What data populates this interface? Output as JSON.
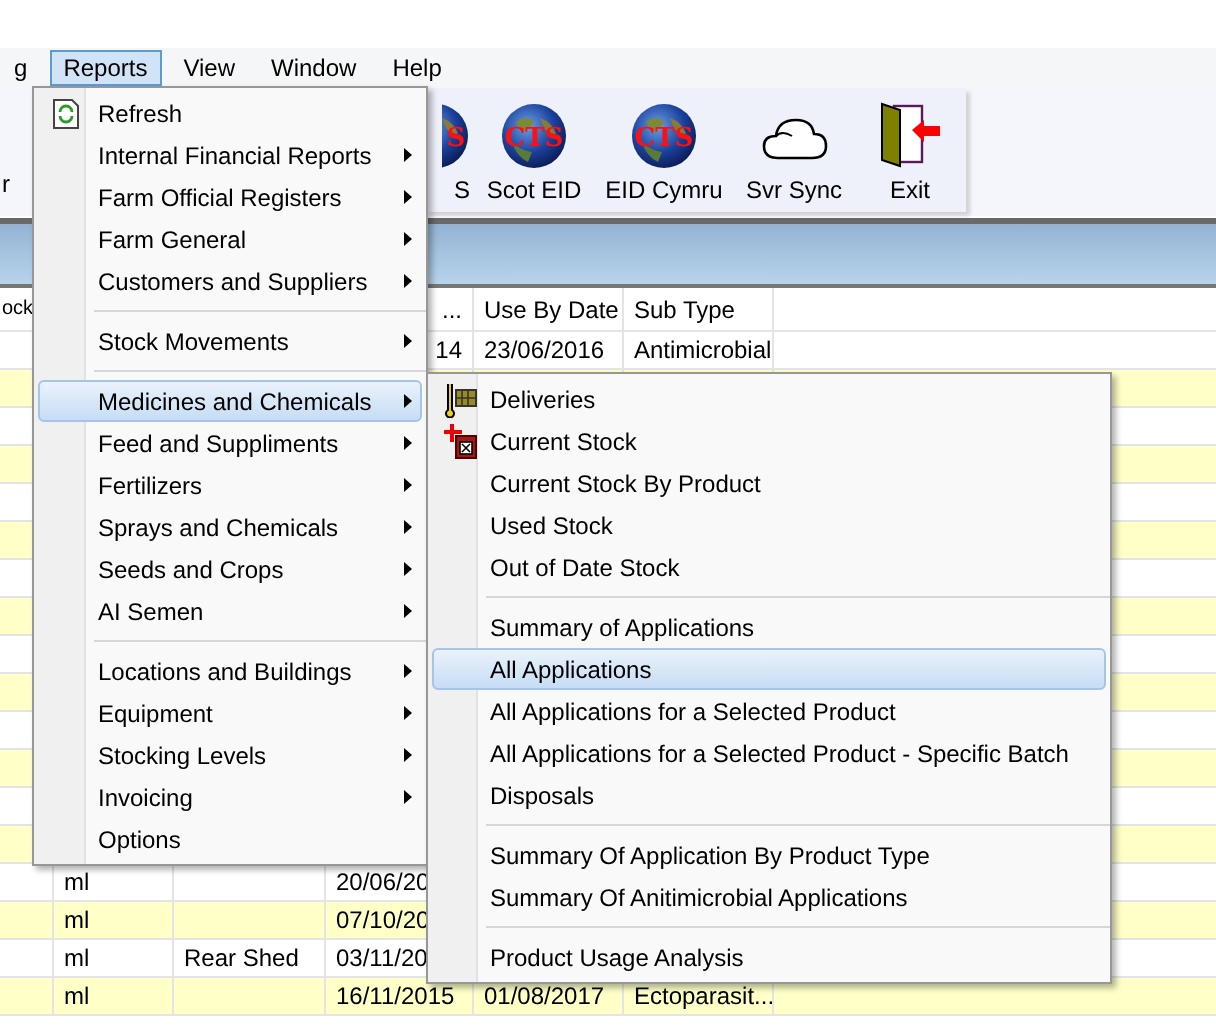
{
  "menu_bar": [
    {
      "label": "g",
      "selected": false
    },
    {
      "label": "Reports",
      "selected": true
    },
    {
      "label": "View",
      "selected": false
    },
    {
      "label": "Window",
      "selected": false
    },
    {
      "label": "Help",
      "selected": false
    }
  ],
  "toolbar": {
    "left_label": "r",
    "buttons": [
      {
        "label": "S",
        "badge": "S",
        "kind": "globe"
      },
      {
        "label": "Scot EID",
        "badge": "CTS",
        "kind": "globe"
      },
      {
        "label": "EID Cymru",
        "badge": "CTS",
        "kind": "globe"
      },
      {
        "label": "Svr Sync",
        "kind": "cloud"
      },
      {
        "label": "Exit",
        "kind": "door"
      }
    ]
  },
  "grid": {
    "columns": [
      "ock",
      "...",
      "Use By Date",
      "Sub Type"
    ],
    "top_rows": [
      {
        "column_4": "14",
        "column_5": "23/06/2016",
        "column_6": "Antimicrobial"
      }
    ],
    "bottom_rows": [
      {
        "column_2": "ml",
        "column_4": "20/06/20"
      },
      {
        "column_2": "ml",
        "column_4": "07/10/20"
      },
      {
        "column_2": "ml",
        "column_3": "Rear Shed",
        "column_4": "03/11/20"
      },
      {
        "column_2": "ml",
        "column_4": "16/11/2015",
        "column_5": "01/08/2017",
        "column_6": "Ectoparasit..."
      }
    ]
  },
  "reports_menu": [
    {
      "kind": "item",
      "label": "Refresh",
      "submenu": false,
      "selected": false
    },
    {
      "kind": "item",
      "label": "Internal Financial Reports",
      "submenu": true,
      "selected": false
    },
    {
      "kind": "item",
      "label": "Farm Official Registers",
      "submenu": true,
      "selected": false
    },
    {
      "kind": "item",
      "label": "Farm General",
      "submenu": true,
      "selected": false
    },
    {
      "kind": "item",
      "label": "Customers and Suppliers",
      "submenu": true,
      "selected": false
    },
    {
      "kind": "separator"
    },
    {
      "kind": "item",
      "label": "Stock Movements",
      "submenu": true,
      "selected": false
    },
    {
      "kind": "separator"
    },
    {
      "kind": "item",
      "label": "Medicines and Chemicals",
      "submenu": true,
      "selected": true
    },
    {
      "kind": "item",
      "label": "Feed and Suppliments",
      "submenu": true,
      "selected": false
    },
    {
      "kind": "item",
      "label": "Fertilizers",
      "submenu": true,
      "selected": false
    },
    {
      "kind": "item",
      "label": "Sprays and Chemicals",
      "submenu": true,
      "selected": false
    },
    {
      "kind": "item",
      "label": "Seeds and Crops",
      "submenu": true,
      "selected": false
    },
    {
      "kind": "item",
      "label": "AI Semen",
      "submenu": true,
      "selected": false
    },
    {
      "kind": "separator"
    },
    {
      "kind": "item",
      "label": "Locations and Buildings",
      "submenu": true,
      "selected": false
    },
    {
      "kind": "item",
      "label": "Equipment",
      "submenu": true,
      "selected": false
    },
    {
      "kind": "item",
      "label": "Stocking Levels",
      "submenu": true,
      "selected": false
    },
    {
      "kind": "item",
      "label": "Invoicing",
      "submenu": true,
      "selected": false
    },
    {
      "kind": "item",
      "label": "Options",
      "submenu": false,
      "selected": false
    }
  ],
  "medicines_submenu": [
    {
      "kind": "item",
      "label": "Deliveries",
      "selected": false
    },
    {
      "kind": "item",
      "label": "Current Stock",
      "selected": false
    },
    {
      "kind": "item",
      "label": "Current Stock By Product",
      "selected": false
    },
    {
      "kind": "item",
      "label": "Used Stock",
      "selected": false
    },
    {
      "kind": "item",
      "label": "Out of Date Stock",
      "selected": false
    },
    {
      "kind": "separator"
    },
    {
      "kind": "item",
      "label": "Summary of Applications",
      "selected": false
    },
    {
      "kind": "item",
      "label": "All Applications",
      "selected": true
    },
    {
      "kind": "item",
      "label": "All Applications for a Selected Product",
      "selected": false
    },
    {
      "kind": "item",
      "label": "All Applications for a Selected Product - Specific Batch",
      "selected": false
    },
    {
      "kind": "item",
      "label": "Disposals",
      "selected": false
    },
    {
      "kind": "separator"
    },
    {
      "kind": "item",
      "label": "Summary  Of Application By Product Type",
      "selected": false
    },
    {
      "kind": "item",
      "label": "Summary Of  Anitimicrobial Applications",
      "selected": false
    },
    {
      "kind": "separator"
    },
    {
      "kind": "item",
      "label": "Product Usage Analysis",
      "selected": false
    }
  ]
}
